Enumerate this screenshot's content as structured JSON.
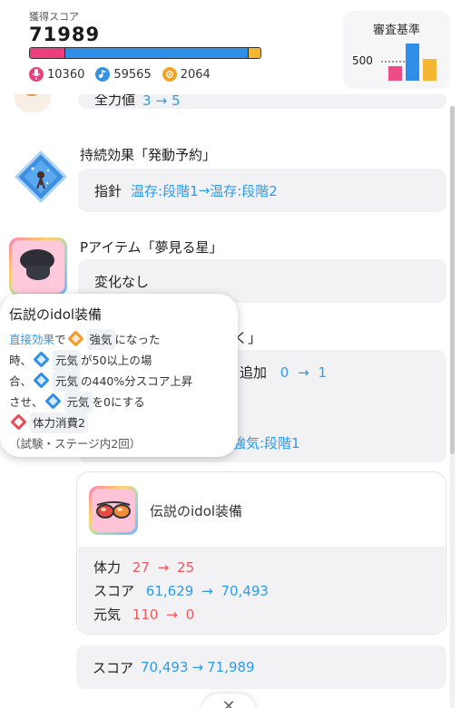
{
  "header": {
    "score_label": "獲得スコア",
    "score_value": "71989",
    "score_bar": {
      "pink_fraction": 0.15,
      "blue_fraction": 0.8,
      "yellow_fraction": 0.05
    },
    "stats": [
      {
        "icon": "microphone-icon",
        "value": "10360",
        "color": "#e8407b"
      },
      {
        "icon": "dance-icon",
        "value": "59565",
        "color": "#3592e6"
      },
      {
        "icon": "visual-icon",
        "value": "2064",
        "color": "#f2a323"
      }
    ],
    "criteria": {
      "title": "審査基準",
      "threshold": "500",
      "bars": {
        "vocal": 0.39,
        "dance": 1.0,
        "visual": 0.59
      }
    }
  },
  "log": {
    "partial_entry": {
      "label": "全力値",
      "before": "3",
      "arrow": "→",
      "after": "5"
    },
    "entries": [
      {
        "title": "持続効果「発動予約」",
        "label": "指針",
        "before": "温存:段階1",
        "arrow": "→",
        "after": "温存:段階2",
        "icon": "pending-effect-icon"
      },
      {
        "title": "Pアイテム「夢見る星」",
        "text": "変化なし",
        "icon": "star-hat-item-icon"
      }
    ],
    "hidden_entry": {
      "title_tail": "く」",
      "row1_label": "追加",
      "row1_before": "0",
      "row1_arrow": "→",
      "row1_after": "1",
      "row2_after": "強気:段階1"
    }
  },
  "tooltip": {
    "title": "伝説のidol装備",
    "direct_effect": "直接効果",
    "line1_de": "で",
    "strong": "強気",
    "line1_end": "になった",
    "line2_start": "時、",
    "genki": "元気",
    "line2_end": "が50以上の場",
    "line3_start": "合、",
    "line3_end": "の440%分スコア上昇",
    "line4_start": "させ、",
    "line4_end": "を0にする",
    "hp_cost": "体力消費2",
    "limit": "（試験・ステージ内2回）"
  },
  "card": {
    "name": "伝説のidol装備",
    "icon": "sunglasses-card-icon",
    "rows": [
      {
        "label": "体力",
        "before": "27",
        "arrow": "→",
        "after": "25",
        "color": "red"
      },
      {
        "label": "スコア",
        "before": "61,629",
        "arrow": "→",
        "after": "70,493",
        "color": "blue"
      },
      {
        "label": "元気",
        "before": "110",
        "arrow": "→",
        "after": "0",
        "color": "red"
      }
    ]
  },
  "total": {
    "label": "スコア",
    "before": "70,493",
    "arrow": "→",
    "after": "71,989"
  },
  "close": {
    "icon": "close-icon"
  }
}
